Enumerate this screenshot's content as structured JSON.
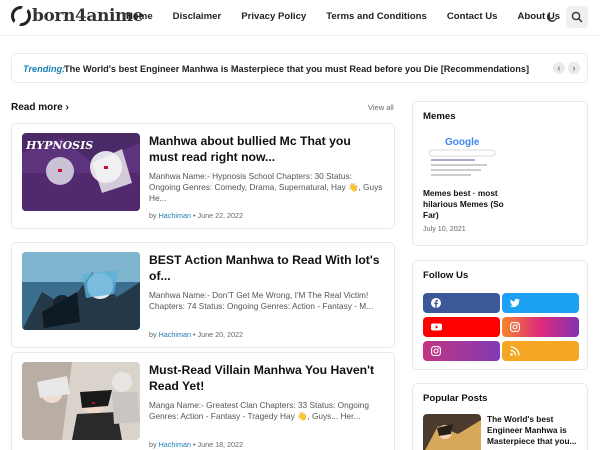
{
  "site": {
    "logo_text": "born4anime"
  },
  "nav": {
    "items": [
      "Home",
      "Disclaimer",
      "Privacy Policy",
      "Terms and Conditions",
      "Contact Us",
      "About Us"
    ]
  },
  "trending": {
    "label": "Trending:",
    "text": "The World's best Engineer Manhwa is Masterpiece that you must Read before you Die [Recommendations]"
  },
  "main": {
    "section_title": "Read more",
    "view_all": "View all",
    "posts": [
      {
        "title": "Manhwa about bullied Mc That you must read right now...",
        "snippet": "Manhwa Name:- Hypnosis School Chapters: 30 Status: Ongoing Genres: Comedy, Drama, Supernatural, Hay 👋, Guys He...",
        "author": "Hachiman",
        "date": "June 22, 2022"
      },
      {
        "title": "BEST Action Manhwa to Read With lot's of...",
        "snippet": "Manhwa Name:- Don'T Get Me Wrong, I'M The Real Victim! Chapters: 74 Status: Ongoing Genres: Action - Fantasy - M...",
        "author": "Hachiman",
        "date": "June 20, 2022"
      },
      {
        "title": "Must-Read Villain Manhwa You Haven't Read Yet!",
        "snippet": "Manga Name:- Greatest Clan Chapters: 33 Status: Ongoing Genres: Action - Fantasy - Tragedy   Hay 👋, Guys... Her...",
        "author": "Hachiman",
        "date": "June 18, 2022"
      }
    ],
    "meta_sep": "•"
  },
  "sidebar": {
    "memes": {
      "title": "Memes",
      "post_title": "Memes best · most hilarious Memes (So Far)",
      "date": "July 10, 2021",
      "image_text": "Google"
    },
    "follow": {
      "title": "Follow Us",
      "buttons": [
        {
          "name": "facebook",
          "color": "#3b5998"
        },
        {
          "name": "twitter",
          "color": "#1da1f2"
        },
        {
          "name": "youtube",
          "color": "#ff0000"
        },
        {
          "name": "instagram",
          "color": "#e1306c"
        },
        {
          "name": "instagram",
          "color": "#c13584"
        },
        {
          "name": "rss",
          "color": "#f5a623"
        }
      ]
    },
    "popular": {
      "title": "Popular Posts",
      "post_title": "The World's best Engineer Manhwa is Masterpiece that you..."
    }
  },
  "icons": [
    "moon-icon",
    "search-icon",
    "chevron-right-icon",
    "chevron-left-icon"
  ]
}
